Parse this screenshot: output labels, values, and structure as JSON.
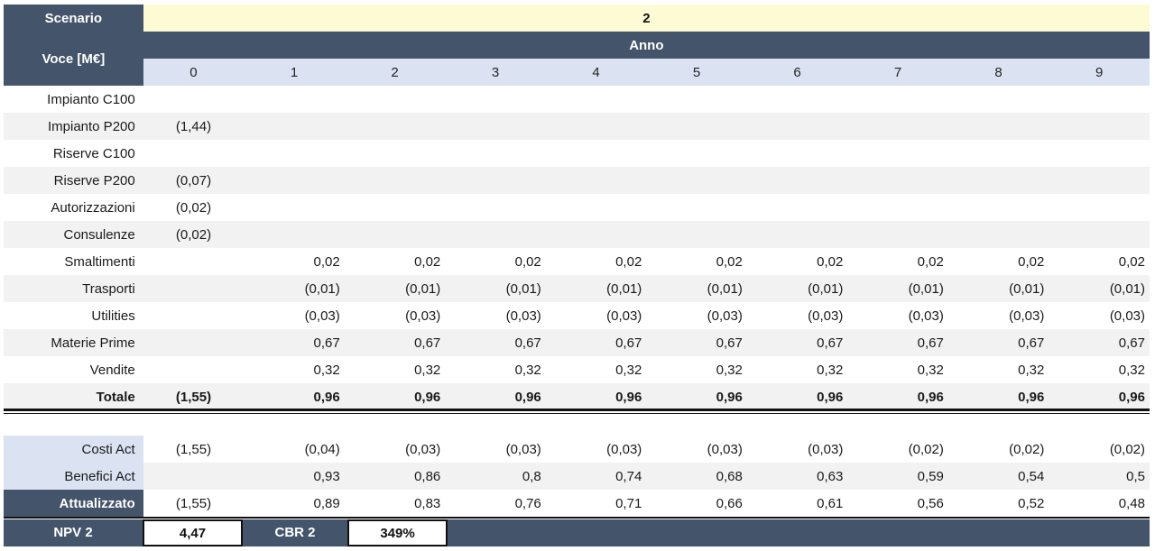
{
  "header": {
    "scenario_label": "Scenario",
    "scenario_value": "2",
    "voce_label": "Voce [M€]",
    "anno_label": "Anno",
    "years": [
      "0",
      "1",
      "2",
      "3",
      "4",
      "5",
      "6",
      "7",
      "8",
      "9"
    ]
  },
  "rows": [
    {
      "label": "Impianto C100",
      "values": [
        "",
        "",
        "",
        "",
        "",
        "",
        "",
        "",
        "",
        ""
      ]
    },
    {
      "label": "Impianto P200",
      "values": [
        "(1,44)",
        "",
        "",
        "",
        "",
        "",
        "",
        "",
        "",
        ""
      ]
    },
    {
      "label": "Riserve C100",
      "values": [
        "",
        "",
        "",
        "",
        "",
        "",
        "",
        "",
        "",
        ""
      ]
    },
    {
      "label": "Riserve P200",
      "values": [
        "(0,07)",
        "",
        "",
        "",
        "",
        "",
        "",
        "",
        "",
        ""
      ]
    },
    {
      "label": "Autorizzazioni",
      "values": [
        "(0,02)",
        "",
        "",
        "",
        "",
        "",
        "",
        "",
        "",
        ""
      ]
    },
    {
      "label": "Consulenze",
      "values": [
        "(0,02)",
        "",
        "",
        "",
        "",
        "",
        "",
        "",
        "",
        ""
      ]
    },
    {
      "label": "Smaltimenti",
      "values": [
        "",
        "0,02",
        "0,02",
        "0,02",
        "0,02",
        "0,02",
        "0,02",
        "0,02",
        "0,02",
        "0,02"
      ]
    },
    {
      "label": "Trasporti",
      "values": [
        "",
        "(0,01)",
        "(0,01)",
        "(0,01)",
        "(0,01)",
        "(0,01)",
        "(0,01)",
        "(0,01)",
        "(0,01)",
        "(0,01)"
      ]
    },
    {
      "label": "Utilities",
      "values": [
        "",
        "(0,03)",
        "(0,03)",
        "(0,03)",
        "(0,03)",
        "(0,03)",
        "(0,03)",
        "(0,03)",
        "(0,03)",
        "(0,03)"
      ]
    },
    {
      "label": "Materie Prime",
      "values": [
        "",
        "0,67",
        "0,67",
        "0,67",
        "0,67",
        "0,67",
        "0,67",
        "0,67",
        "0,67",
        "0,67"
      ]
    },
    {
      "label": "Vendite",
      "values": [
        "",
        "0,32",
        "0,32",
        "0,32",
        "0,32",
        "0,32",
        "0,32",
        "0,32",
        "0,32",
        "0,32"
      ]
    }
  ],
  "total": {
    "label": "Totale",
    "values": [
      "(1,55)",
      "0,96",
      "0,96",
      "0,96",
      "0,96",
      "0,96",
      "0,96",
      "0,96",
      "0,96",
      "0,96"
    ]
  },
  "actualized": [
    {
      "label": "Costi Act",
      "values": [
        "(1,55)",
        "(0,04)",
        "(0,03)",
        "(0,03)",
        "(0,03)",
        "(0,03)",
        "(0,03)",
        "(0,02)",
        "(0,02)",
        "(0,02)"
      ]
    },
    {
      "label": "Benefici Act",
      "values": [
        "",
        "0,93",
        "0,86",
        "0,8",
        "0,74",
        "0,68",
        "0,63",
        "0,59",
        "0,54",
        "0,5"
      ]
    }
  ],
  "attualizzato": {
    "label": "Attualizzato",
    "values": [
      "(1,55)",
      "0,89",
      "0,83",
      "0,76",
      "0,71",
      "0,66",
      "0,61",
      "0,56",
      "0,52",
      "0,48"
    ]
  },
  "summary": {
    "npv_label": "NPV 2",
    "npv_value": "4,47",
    "cbr_label": "CBR 2",
    "cbr_value": "349%"
  },
  "colors": {
    "dark_header": "#44546a",
    "light_header": "#dbe3f3",
    "scenario_fill": "#fdfbd3",
    "row_alt": "#f2f2f2"
  }
}
